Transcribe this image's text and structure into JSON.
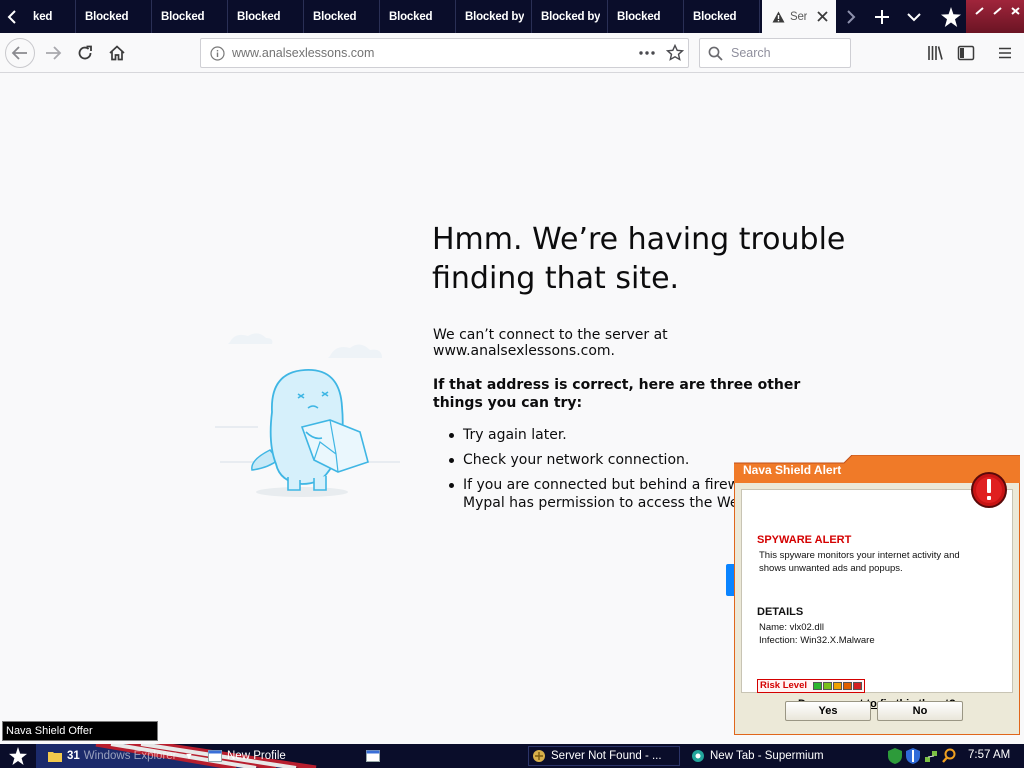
{
  "browser": {
    "tabs": [
      {
        "label": "ked",
        "active": false
      },
      {
        "label": "Blocked",
        "active": false
      },
      {
        "label": "Blocked",
        "active": false
      },
      {
        "label": "Blocked",
        "active": false
      },
      {
        "label": "Blocked",
        "active": false
      },
      {
        "label": "Blocked",
        "active": false
      },
      {
        "label": "Blocked by",
        "active": false
      },
      {
        "label": "Blocked by",
        "active": false
      },
      {
        "label": "Blocked",
        "active": false
      },
      {
        "label": "Blocked",
        "active": false
      },
      {
        "label": "Ser",
        "active": true,
        "icon": "warning-icon"
      }
    ],
    "url": "www.analsexlessons.com",
    "search_placeholder": "Search"
  },
  "error_page": {
    "title": "Hmm. We’re having trouble finding that site.",
    "description": "We can’t connect to the server at www.analsexlessons.com.",
    "suggest_heading": "If that address is correct, here are three other things you can try:",
    "suggestions": [
      "Try again later.",
      "Check your network connection.",
      "If you are connected but behind a firewall"
    ],
    "suggestion_3_line2": "Mypal has permission to access the Web."
  },
  "nava_popup": {
    "title": "Nava Shield Alert",
    "spyware_title": "SPYWARE ALERT",
    "spyware_text": "This spyware monitors your internet activity and shows unwanted ads and popups.",
    "details_title": "DETAILS",
    "name": "Name: vlx02.dll",
    "infection": "Infection: Win32.X.Malware",
    "risk_label": "Risk Level",
    "risk_colors": [
      "#2db52d",
      "#7ac01a",
      "#f0a000",
      "#e06000",
      "#d42020"
    ],
    "question": "Do you want to fix this threat?",
    "yes": "Yes",
    "no": "No",
    "accent_color": "#f07a28"
  },
  "tooltip": "Nava Shield Offer",
  "taskbar": {
    "explorer_count": "31",
    "explorer_label": "Windows Explorer",
    "newprofile_label": "New Profile",
    "server_label": "Server Not Found - ...",
    "supermium_label": "New Tab - Supermium",
    "clock": "7:57 AM"
  }
}
